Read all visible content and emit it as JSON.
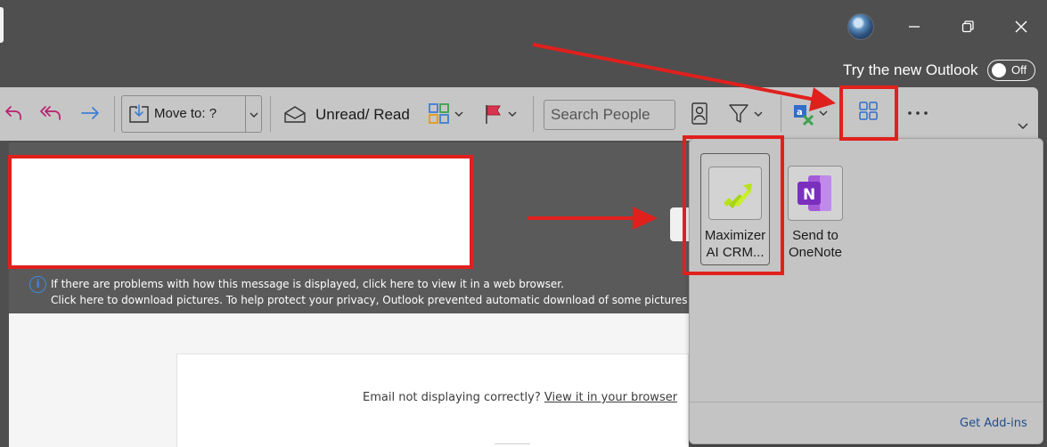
{
  "window": {
    "try_new_label": "Try the new Outlook",
    "toggle_state": "Off"
  },
  "ribbon": {
    "move_to_label": "Move to: ?",
    "unread_read_label": "Unread/ Read",
    "search_people_placeholder": "Search People",
    "icons": [
      "reply-icon",
      "reply-all-icon",
      "forward-icon",
      "move-to-folder-icon",
      "envelope-open-icon",
      "categorize-icon",
      "flag-icon",
      "address-book-icon",
      "filter-icon",
      "translate-icon",
      "apps-icon",
      "more-options-icon",
      "collapse-ribbon-icon"
    ]
  },
  "message": {
    "info_line_1": "If there are problems with how this message is displayed, click here to view it in a web browser.",
    "info_line_2": "Click here to download pictures. To help protect your privacy, Outlook prevented automatic download of some pictures in",
    "email_notice": "Email not displaying correctly? ",
    "view_link": "View it in your browser"
  },
  "addins_panel": {
    "items": [
      {
        "line1": "Maximizer",
        "line2": "AI CRM..."
      },
      {
        "line1": "Send to",
        "line2": "OneNote"
      }
    ],
    "get_addins_label": "Get Add-ins"
  },
  "colors": {
    "annotation_red": "#e0201d",
    "accent_blue": "#3d7fd4",
    "reply_magenta": "#b8226e",
    "onenote_purple": "#7b2fbf"
  }
}
